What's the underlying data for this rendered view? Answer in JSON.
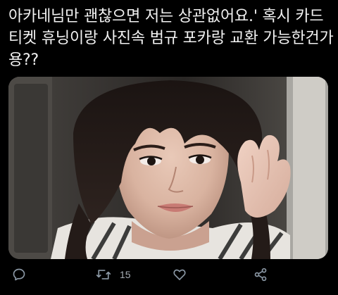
{
  "tweet": {
    "text": "아카네님만 괜찮으면 저는 상관없어요.' 혹시 카드티켓 휴닝이랑 사진속 범규 포카랑 교환 가능한건가용??",
    "media": {
      "alt": "photocard"
    }
  },
  "actions": {
    "reply_icon": "reply-icon",
    "retweet_icon": "retweet-icon",
    "retweet_count": "15",
    "like_icon": "heart-icon",
    "share_icon": "share-icon"
  },
  "colors": {
    "background": "#000000",
    "text": "#f2f2f2",
    "icon": "#8b98a5"
  }
}
